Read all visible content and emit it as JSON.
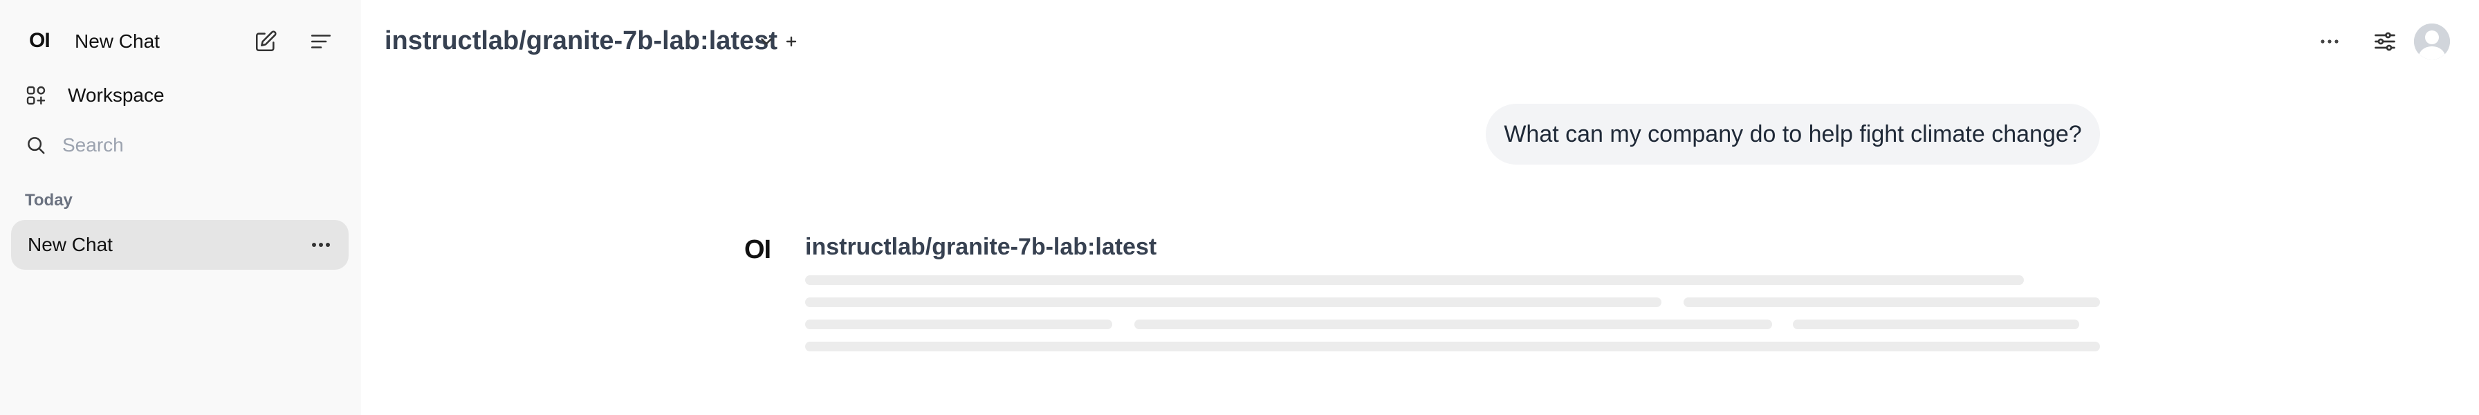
{
  "sidebar": {
    "logo": "OI",
    "new_chat_label": "New Chat",
    "workspace_label": "Workspace",
    "search_placeholder": "Search",
    "section_today": "Today",
    "chats": [
      {
        "label": "New Chat"
      }
    ]
  },
  "header": {
    "model_name": "instructlab/granite-7b-lab:latest"
  },
  "conversation": {
    "user_message": "What can my company do to help fight climate change?",
    "assistant": {
      "logo": "OI",
      "model_name": "instructlab/granite-7b-lab:latest",
      "state": "loading"
    }
  },
  "colors": {
    "sidebar_bg": "#f9f9f9",
    "active_chat_bg": "#e5e5e5",
    "user_bubble_bg": "#f3f4f6",
    "skeleton": "#ececec"
  },
  "icons": [
    "edit-icon",
    "sidebar-menu-icon",
    "workspace-icon",
    "search-icon",
    "ellipsis-icon",
    "chevron-down-icon",
    "plus-icon",
    "controls-icon",
    "avatar"
  ]
}
